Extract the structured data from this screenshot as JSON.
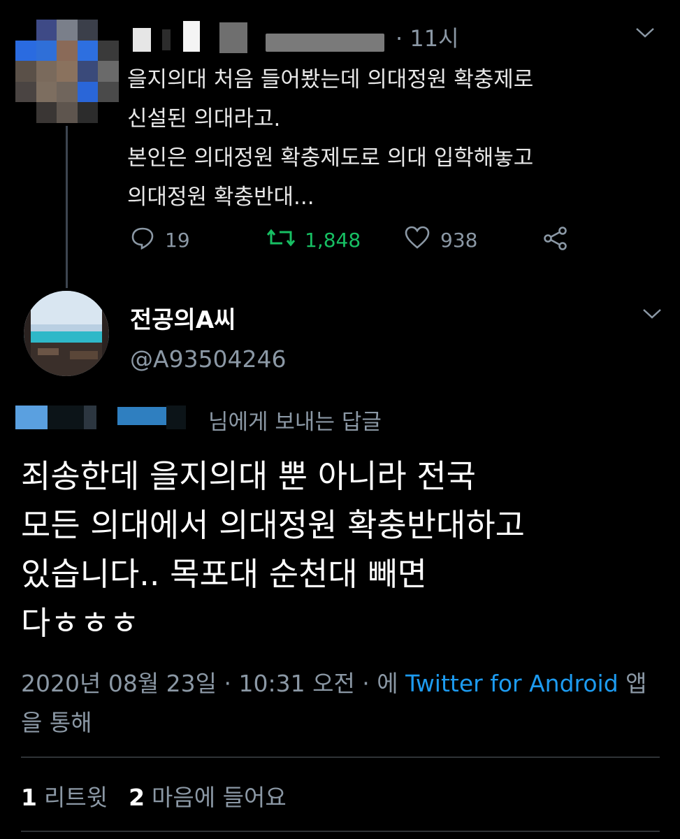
{
  "parent_tweet": {
    "time": "· 11시",
    "text": "을지의대 처음 들어봤는데 의대정원 확충제로\n신설된 의대라고.\n본인은 의대정원 확충제도로 의대 입학해놓고\n의대정원 확충반대...",
    "actions": {
      "reply_count": "19",
      "retweet_count": "1,848",
      "like_count": "938"
    },
    "icons": [
      "reply-icon",
      "retweet-icon",
      "like-icon",
      "share-icon",
      "chevron-down-icon"
    ]
  },
  "main_tweet": {
    "display_name": "전공의A씨",
    "handle": "@A93504246",
    "replying_to_suffix": "님에게 보내는 답글",
    "text": "죄송한데 을지의대 뿐 아니라 전국\n모든 의대에서 의대정원 확충반대하고\n있습니다.. 목포대 순천대 빼면\n다ㅎㅎㅎ",
    "meta_prefix": "2020년 08월 23일 · 10:31 오전 · 에 ",
    "meta_link": "Twitter for Android",
    "meta_suffix": " 앱을 통해",
    "stats": {
      "retweets_count": "1",
      "retweets_label": "리트윗",
      "likes_count": "2",
      "likes_label": "마음에 들어요"
    }
  },
  "colors": {
    "background": "#000000",
    "secondary_text": "#8b98a5",
    "link": "#1d9bf0",
    "retweet_green": "#17bf63",
    "divider": "#2f3336"
  }
}
